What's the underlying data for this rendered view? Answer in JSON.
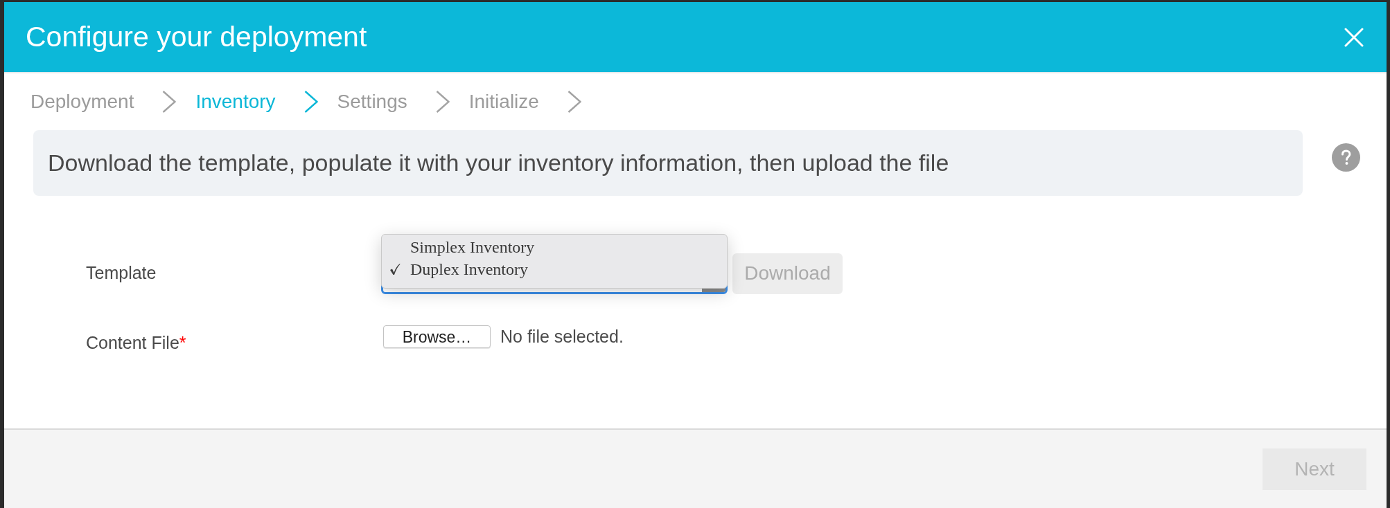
{
  "dialog": {
    "title": "Configure your deployment"
  },
  "steps": [
    {
      "label": "Deployment",
      "selected": false
    },
    {
      "label": "Inventory",
      "selected": true
    },
    {
      "label": "Settings",
      "selected": false
    },
    {
      "label": "Initialize",
      "selected": false
    }
  ],
  "banner": {
    "text": "Download the template, populate it with your inventory information, then upload the file"
  },
  "form": [
    {
      "kind": "select",
      "label": "Template",
      "expanded": true,
      "options": [
        {
          "label": "Simplex Inventory",
          "selected": false
        },
        {
          "label": "Duplex Inventory",
          "selected": true
        }
      ],
      "button": {
        "label": "Download",
        "disabled": true
      }
    },
    {
      "kind": "file",
      "label": "Content File",
      "required_mark": "*",
      "button": {
        "label": "Browse…"
      },
      "status": "No file selected."
    }
  ],
  "footer": {
    "buttons": [
      {
        "label": "Next",
        "disabled": true
      }
    ]
  }
}
